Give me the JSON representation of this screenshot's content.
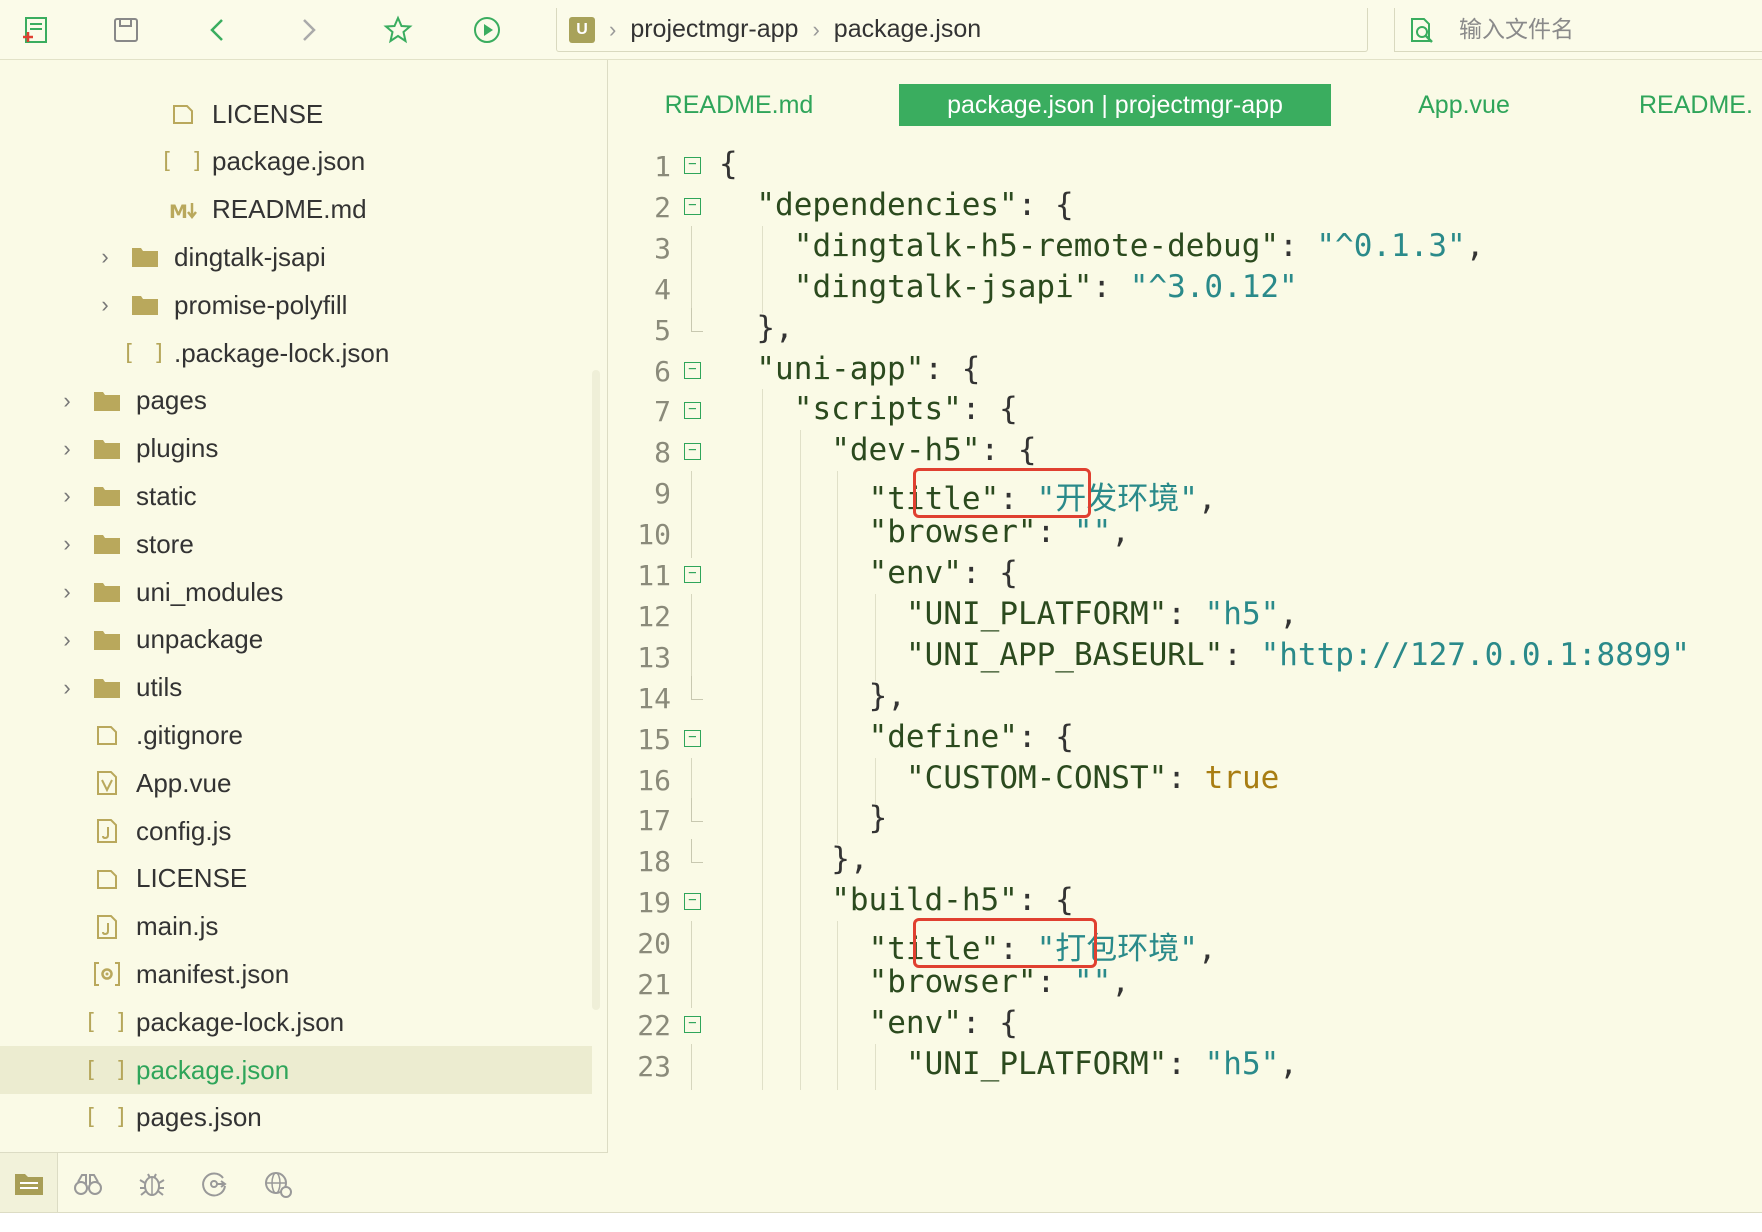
{
  "breadcrumb": {
    "logo": "U",
    "project": "projectmgr-app",
    "file": "package.json"
  },
  "search": {
    "placeholder": "输入文件名"
  },
  "toolbar_icons": [
    "new-file-icon",
    "save-icon",
    "back-icon",
    "forward-icon",
    "star-icon",
    "run-icon"
  ],
  "sidebar": {
    "items": [
      {
        "label": "LICENSE",
        "icon": "file-icon",
        "depth": 3,
        "chevron": false
      },
      {
        "label": "package.json",
        "icon": "json-icon",
        "depth": 3,
        "chevron": false
      },
      {
        "label": "README.md",
        "icon": "markdown-icon",
        "depth": 3,
        "chevron": false
      },
      {
        "label": "dingtalk-jsapi",
        "icon": "folder-icon",
        "depth": 2,
        "chevron": true
      },
      {
        "label": "promise-polyfill",
        "icon": "folder-icon",
        "depth": 2,
        "chevron": true
      },
      {
        "label": ".package-lock.json",
        "icon": "json-icon",
        "depth": 2,
        "chevron": false
      },
      {
        "label": "pages",
        "icon": "folder-icon",
        "depth": 1,
        "chevron": true
      },
      {
        "label": "plugins",
        "icon": "folder-icon",
        "depth": 1,
        "chevron": true
      },
      {
        "label": "static",
        "icon": "folder-icon",
        "depth": 1,
        "chevron": true
      },
      {
        "label": "store",
        "icon": "folder-icon",
        "depth": 1,
        "chevron": true
      },
      {
        "label": "uni_modules",
        "icon": "folder-icon",
        "depth": 1,
        "chevron": true
      },
      {
        "label": "unpackage",
        "icon": "folder-icon",
        "depth": 1,
        "chevron": true
      },
      {
        "label": "utils",
        "icon": "folder-icon",
        "depth": 1,
        "chevron": true
      },
      {
        "label": ".gitignore",
        "icon": "file-icon",
        "depth": 1,
        "chevron": false
      },
      {
        "label": "App.vue",
        "icon": "vue-icon",
        "depth": 1,
        "chevron": false
      },
      {
        "label": "config.js",
        "icon": "js-icon",
        "depth": 1,
        "chevron": false
      },
      {
        "label": "LICENSE",
        "icon": "file-icon",
        "depth": 1,
        "chevron": false
      },
      {
        "label": "main.js",
        "icon": "js-icon",
        "depth": 1,
        "chevron": false
      },
      {
        "label": "manifest.json",
        "icon": "manifest-icon",
        "depth": 1,
        "chevron": false
      },
      {
        "label": "package-lock.json",
        "icon": "json-icon",
        "depth": 1,
        "chevron": false
      },
      {
        "label": "package.json",
        "icon": "json-icon",
        "depth": 1,
        "chevron": false,
        "selected": true
      },
      {
        "label": "pages.json",
        "icon": "json-icon",
        "depth": 1,
        "chevron": false
      }
    ],
    "footer_icons": [
      "project-manager-icon",
      "binoculars-icon",
      "bug-icon",
      "git-icon",
      "plugin-globe-icon"
    ]
  },
  "tabs": [
    {
      "label": "README.md",
      "active": false
    },
    {
      "label": "package.json | projectmgr-app",
      "active": true
    },
    {
      "label": "App.vue",
      "active": false
    },
    {
      "label": "README.",
      "active": false
    }
  ],
  "code": {
    "lines": [
      {
        "n": "1",
        "indent": 0,
        "fold": "open",
        "tokens": [
          [
            "p",
            "{"
          ]
        ]
      },
      {
        "n": "2",
        "indent": 1,
        "fold": "open",
        "tokens": [
          [
            "k",
            "\"dependencies\""
          ],
          [
            "p",
            ": {"
          ]
        ]
      },
      {
        "n": "3",
        "indent": 2,
        "fold": "bar",
        "tokens": [
          [
            "k",
            "\"dingtalk-h5-remote-debug\""
          ],
          [
            "p",
            ": "
          ],
          [
            "s",
            "\"^0.1.3\""
          ],
          [
            "p",
            ","
          ]
        ]
      },
      {
        "n": "4",
        "indent": 2,
        "fold": "bar",
        "tokens": [
          [
            "k",
            "\"dingtalk-jsapi\""
          ],
          [
            "p",
            ": "
          ],
          [
            "s",
            "\"^3.0.12\""
          ]
        ]
      },
      {
        "n": "5",
        "indent": 1,
        "fold": "end",
        "tokens": [
          [
            "p",
            "},"
          ]
        ]
      },
      {
        "n": "6",
        "indent": 1,
        "fold": "open",
        "tokens": [
          [
            "k",
            "\"uni-app\""
          ],
          [
            "p",
            ": {"
          ]
        ]
      },
      {
        "n": "7",
        "indent": 2,
        "fold": "open",
        "tokens": [
          [
            "k",
            "\"scripts\""
          ],
          [
            "p",
            ": {"
          ]
        ]
      },
      {
        "n": "8",
        "indent": 3,
        "fold": "open",
        "tokens": [
          [
            "k",
            "\"dev-h5\""
          ],
          [
            "p",
            ": {"
          ]
        ]
      },
      {
        "n": "9",
        "indent": 4,
        "fold": "bar",
        "tokens": [
          [
            "k",
            "\"title\""
          ],
          [
            "p",
            ": "
          ],
          [
            "s",
            "\"开发环境\""
          ],
          [
            "p",
            ","
          ]
        ]
      },
      {
        "n": "10",
        "indent": 4,
        "fold": "bar",
        "tokens": [
          [
            "k",
            "\"browser\""
          ],
          [
            "p",
            ": "
          ],
          [
            "s",
            "\"\""
          ],
          [
            "p",
            ","
          ]
        ]
      },
      {
        "n": "11",
        "indent": 4,
        "fold": "open",
        "tokens": [
          [
            "k",
            "\"env\""
          ],
          [
            "p",
            ": {"
          ]
        ]
      },
      {
        "n": "12",
        "indent": 5,
        "fold": "bar",
        "tokens": [
          [
            "k",
            "\"UNI_PLATFORM\""
          ],
          [
            "p",
            ": "
          ],
          [
            "s",
            "\"h5\""
          ],
          [
            "p",
            ","
          ]
        ]
      },
      {
        "n": "13",
        "indent": 5,
        "fold": "bar",
        "tokens": [
          [
            "k",
            "\"UNI_APP_BASEURL\""
          ],
          [
            "p",
            ": "
          ],
          [
            "s",
            "\"http://127.0.0.1:8899\""
          ]
        ]
      },
      {
        "n": "14",
        "indent": 4,
        "fold": "end",
        "tokens": [
          [
            "p",
            "},"
          ]
        ]
      },
      {
        "n": "15",
        "indent": 4,
        "fold": "open",
        "tokens": [
          [
            "k",
            "\"define\""
          ],
          [
            "p",
            ": {"
          ]
        ]
      },
      {
        "n": "16",
        "indent": 5,
        "fold": "bar",
        "tokens": [
          [
            "k",
            "\"CUSTOM-CONST\""
          ],
          [
            "p",
            ": "
          ],
          [
            "b",
            "true"
          ]
        ]
      },
      {
        "n": "17",
        "indent": 4,
        "fold": "end",
        "tokens": [
          [
            "p",
            "}"
          ]
        ]
      },
      {
        "n": "18",
        "indent": 3,
        "fold": "end",
        "tokens": [
          [
            "p",
            "},"
          ]
        ]
      },
      {
        "n": "19",
        "indent": 3,
        "fold": "open",
        "tokens": [
          [
            "k",
            "\"build-h5\""
          ],
          [
            "p",
            ": {"
          ]
        ]
      },
      {
        "n": "20",
        "indent": 4,
        "fold": "bar",
        "tokens": [
          [
            "k",
            "\"title\""
          ],
          [
            "p",
            ": "
          ],
          [
            "s",
            "\"打包环境\""
          ],
          [
            "p",
            ","
          ]
        ]
      },
      {
        "n": "21",
        "indent": 4,
        "fold": "bar",
        "tokens": [
          [
            "k",
            "\"browser\""
          ],
          [
            "p",
            ": "
          ],
          [
            "s",
            "\"\""
          ],
          [
            "p",
            ","
          ]
        ]
      },
      {
        "n": "22",
        "indent": 4,
        "fold": "open",
        "tokens": [
          [
            "k",
            "\"env\""
          ],
          [
            "p",
            ": {"
          ]
        ]
      },
      {
        "n": "23",
        "indent": 5,
        "fold": "bar",
        "tokens": [
          [
            "k",
            "\"UNI_PLATFORM\""
          ],
          [
            "p",
            ": "
          ],
          [
            "s",
            "\"h5\""
          ],
          [
            "p",
            ","
          ]
        ]
      }
    ],
    "highlighted_values": [
      "\"开发环境\"",
      "\"打包环境\""
    ]
  },
  "colors": {
    "accent": "#3aad5f",
    "background": "#fafae6",
    "highlight_box": "#e04030",
    "string": "#2a8a8a",
    "boolean": "#a87d12"
  }
}
